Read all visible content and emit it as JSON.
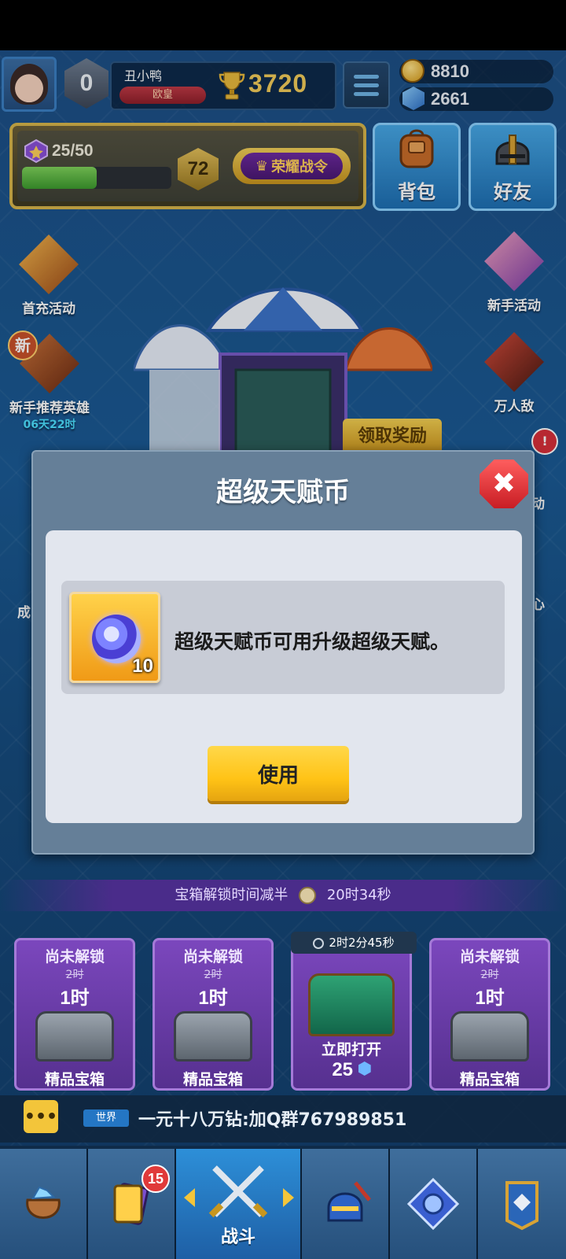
{
  "header": {
    "rank_level": "0",
    "player_name": "丑小鸭",
    "player_title": "欧皇",
    "trophies": "3720",
    "gold": "8810",
    "gems": "2661"
  },
  "level_panel": {
    "xp_text": "25/50",
    "xp_progress": 0.5,
    "level": "72",
    "honor_pass_label": "荣耀战令"
  },
  "top_buttons": {
    "backpack": "背包",
    "friends": "好友"
  },
  "left_events": [
    {
      "label": "首充活动"
    },
    {
      "label": "新手推荐英雄",
      "badge": "新",
      "countdown": "06天22时"
    },
    {
      "label": "成"
    }
  ],
  "right_events": [
    {
      "label": "新手活动"
    },
    {
      "label": "万人敌"
    },
    {
      "label": "动"
    },
    {
      "label": "心"
    }
  ],
  "building": {
    "claim_label": "领取奖励"
  },
  "modal": {
    "title": "超级天赋币",
    "item_count": "10",
    "item_description": "超级天赋币可用升级超级天赋。",
    "use_button": "使用"
  },
  "chest_reduce": {
    "label": "宝箱解锁时间减半",
    "time": "20时34秒"
  },
  "chests": [
    {
      "status": "尚未解锁",
      "old_time": "2时",
      "time": "1时",
      "name": "精品宝箱"
    },
    {
      "status": "尚未解锁",
      "old_time": "2时",
      "time": "1时",
      "name": "精品宝箱"
    },
    {
      "timer": "2时2分45秒",
      "action": "立即打开",
      "cost": "25"
    },
    {
      "status": "尚未解锁",
      "old_time": "2时",
      "time": "1时",
      "name": "精品宝箱"
    }
  ],
  "chat": {
    "channel": "世界",
    "message": "一元十八万钻:加Q群767989851"
  },
  "bottom_nav": {
    "cards_badge": "15",
    "battle_label": "战斗"
  },
  "colors": {
    "accent_blue": "#2d8fd8",
    "modal_bg": "#657f98",
    "use_button": "#ffc316",
    "close_red": "#e03a3a"
  }
}
